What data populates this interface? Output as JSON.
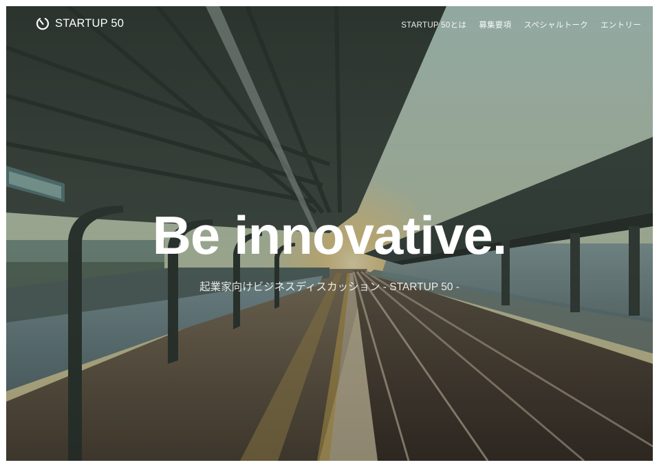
{
  "brand": {
    "logo_icon": "power-clock-icon",
    "name": "STARTUP 50"
  },
  "nav": {
    "items": [
      {
        "label": "STARTUP 50とは"
      },
      {
        "label": "募集要項"
      },
      {
        "label": "スペシャルトーク"
      },
      {
        "label": "エントリー"
      }
    ]
  },
  "hero": {
    "title": "Be innovative.",
    "subtitle": "起業家向けビジネスディスカッション - STARTUP 50 -",
    "background": "train-platform-sunrise-photo"
  },
  "colors": {
    "text": "#ffffff",
    "sky": "#b9cdb8",
    "sun": "#f6d58a",
    "canopy": "#3a443c"
  }
}
